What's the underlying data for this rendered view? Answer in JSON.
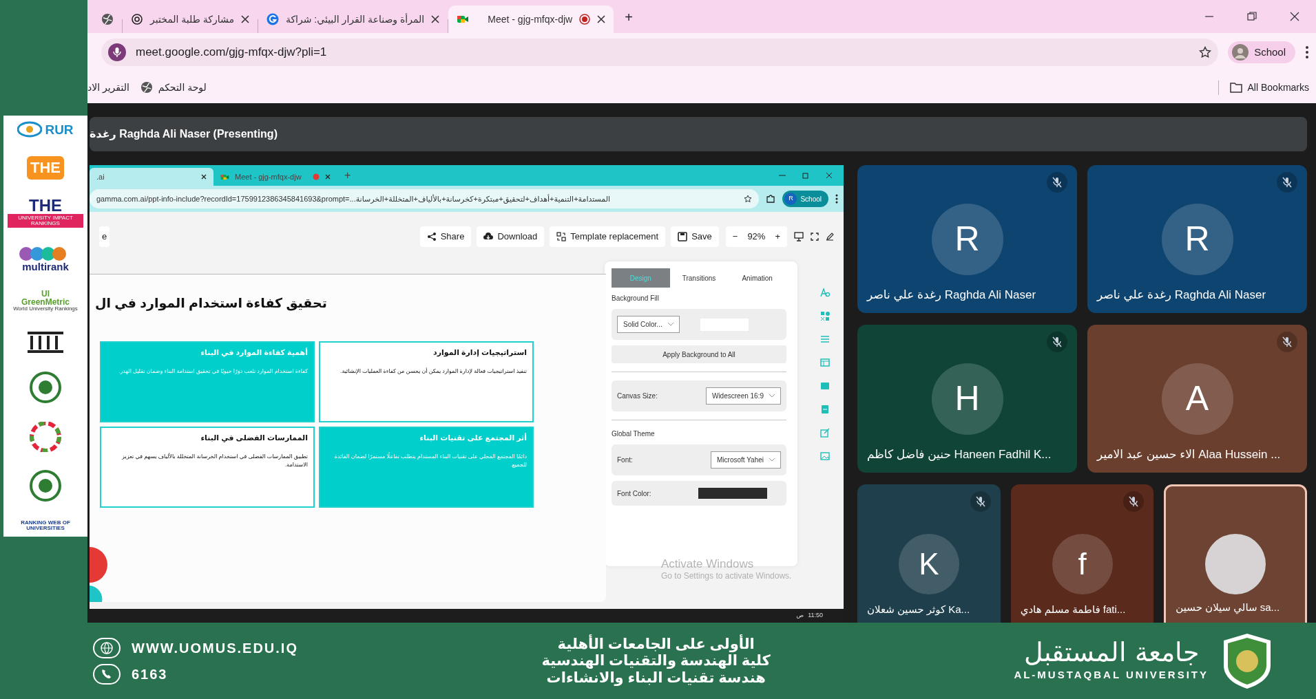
{
  "logos": [
    {
      "kind": "rur",
      "text": "RUR"
    },
    {
      "kind": "the",
      "text": "THE"
    },
    {
      "kind": "impact",
      "text": "THE",
      "subtext": "UNIVERSITY IMPACT RANKINGS"
    },
    {
      "kind": "multirank",
      "text": "multirank"
    },
    {
      "kind": "greenmetric",
      "text": "UI GreenMetric",
      "subtext": "World University Rankings"
    },
    {
      "kind": "columns"
    },
    {
      "kind": "emblem"
    },
    {
      "kind": "sdg"
    },
    {
      "kind": "emblem"
    },
    {
      "kind": "webometrics",
      "text": "RANKING WEB OF UNIVERSITIES"
    }
  ],
  "browser": {
    "tabs": [
      {
        "kind": "meet",
        "title": "Meet - gjg-mfqx-djw",
        "selected": true,
        "recording": true
      },
      {
        "kind": "g",
        "title": "المرأة وصناعة القرار البيئي: شراكة",
        "selected": false
      },
      {
        "kind": "spiral",
        "title": "مشاركة طلبة المختبر",
        "selected": false
      },
      {
        "kind": "globe",
        "selected": false
      }
    ],
    "new_tab": "+",
    "url": "meet.google.com/gjg-mfqx-djw?pli=1",
    "profile": "School",
    "bookmarks": [
      {
        "kind": "globe",
        "label": "لوحة التحكم"
      },
      {
        "kind": "plain",
        "label": "التقرير الاد"
      }
    ],
    "all_bookmarks": "All Bookmarks"
  },
  "meet": {
    "presenting": "رغدة Raghda Ali Naser (Presenting)",
    "shared_screen": {
      "tabs": [
        {
          "kind": "meet",
          "title": "Meet - gjg-mfqx-djw",
          "selected": false,
          "recording": true
        },
        {
          "kind": "plain",
          "title": ".ai",
          "selected": true
        }
      ],
      "new_tab": "+",
      "url": "gamma.com.ai/ppt-info-include?recordId=1759912386345841693&prompt=...المستدامة+التنمية+أهداف+لتحقيق+مبتكرة+كخرسانة+بالألياف+المتخللة+الخرسانة",
      "profile_initial": "R",
      "profile": "School",
      "toolbar_cut": "e",
      "toolbar": [
        {
          "kind": "save",
          "label": "Save"
        },
        {
          "kind": "template",
          "label": "Template replacement"
        },
        {
          "kind": "download",
          "label": "Download"
        },
        {
          "kind": "share",
          "label": "Share"
        }
      ],
      "zoom": {
        "minus": "−",
        "value": "92%",
        "plus": "+"
      },
      "slide": {
        "title": "تحقيق كفاءة استخدام الموارد في ال",
        "cards": [
          {
            "filled": false,
            "heading": "استراتيجيات إدارة الموارد",
            "body": "تنفيذ استراتيجيات فعالة لإدارة الموارد يمكن أن يحسن من كفاءة العمليات الإنشائية."
          },
          {
            "filled": true,
            "heading": "أهمية كفاءة الموارد في البناء",
            "body": "كفاءة استخدام الموارد تلعب دورًا حيويًا في تحقيق استدامة البناء وضمان تقليل الهدر."
          },
          {
            "filled": true,
            "heading": "أثر المجتمع على تقنيات البناء",
            "body": "دائمًا المجتمع المحلي على تقنيات البناء المستدام يتطلب تفاعلًا مستمرًا لضمان الفائدة للجميع."
          },
          {
            "filled": false,
            "heading": "الممارسات الفضلى في البناء",
            "body": "تطبيق الممارسات الفضلى في استخدام الخرسانة المتخللة بالألياف يسهم في تعزيز الاستدامة."
          }
        ]
      },
      "panel": {
        "tabs": [
          {
            "label": "Animation",
            "selected": false
          },
          {
            "label": "Transitions",
            "selected": false
          },
          {
            "label": "Design",
            "selected": true
          }
        ],
        "background_fill": "Background Fill",
        "fill_select": "Solid Color...",
        "apply_all": "Apply Background to All",
        "canvas_label": "Canvas Size:",
        "canvas_value": "Widescreen 16:9",
        "global_theme": "Global Theme",
        "font_label": "Font:",
        "font_value": "Microsoft Yahei",
        "font_color_label": "Font Color:"
      },
      "activation": {
        "title": "Activate Windows",
        "hint": "Go to Settings to activate Windows."
      },
      "taskbar": {
        "time": "11:50",
        "period": "ص"
      }
    },
    "participants": [
      {
        "name": "رغدة علي ناصر Raghda Ali Naser",
        "initial": "R",
        "kind": "initial",
        "color": "#0e4470",
        "muted": true,
        "speaking": false
      },
      {
        "name": "رغدة علي ناصر Raghda Ali Naser",
        "initial": "R",
        "kind": "initial",
        "color": "#0e4470",
        "muted": true,
        "speaking": false
      },
      {
        "name": "الاء حسين عبد الامير Alaa Hussein ...",
        "initial": "A",
        "kind": "initial",
        "color": "#6b3f2e",
        "muted": true,
        "speaking": false
      },
      {
        "name": "حنين فاضل كاظم Haneen Fadhil K...",
        "initial": "H",
        "kind": "initial",
        "color": "#0f4436",
        "muted": true,
        "speaking": false
      },
      {
        "name": "سالي سيلان حسين sa...",
        "kind": "photo",
        "color": "#6d4433",
        "muted": false,
        "speaking": true
      },
      {
        "name": "فاطمة مسلم هادي fati...",
        "initial": "f",
        "kind": "initial",
        "color": "#5a2a1c",
        "muted": true,
        "speaking": false
      },
      {
        "name": "كوثر حسين شعلان Ka...",
        "initial": "K",
        "kind": "initial",
        "color": "#1f3f4c",
        "muted": true,
        "speaking": false
      }
    ]
  },
  "banner": {
    "website": "WWW.UOMUS.EDU.IQ",
    "phone": "6163",
    "lines": [
      "الأولى على الجامعات الأهلية",
      "كلية الهندسة والتقنيات الهندسية",
      "هندسة تقنيات البناء والانشاءات"
    ],
    "university_ar": "جامعة المستقبل",
    "university_en": "AL-MUSTAQBAL UNIVERSITY"
  }
}
